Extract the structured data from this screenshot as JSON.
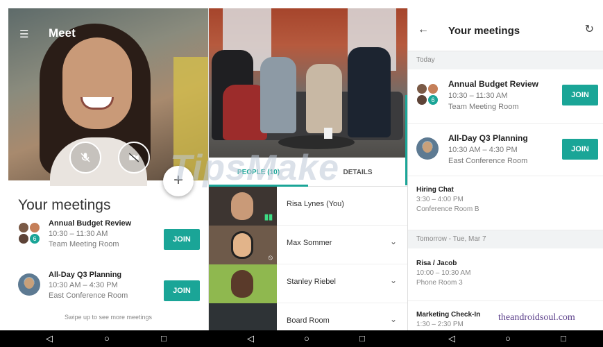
{
  "panel1": {
    "app_title": "Meet",
    "heading": "Your meetings",
    "fab_label": "+",
    "meetings": [
      {
        "title": "Annual Budget Review",
        "time": "10:30 – 11:30 AM",
        "room": "Team Meeting Room",
        "join": "JOIN"
      },
      {
        "title": "All-Day Q3 Planning",
        "time": "10:30 AM – 4:30 PM",
        "room": "East Conference Room",
        "join": "JOIN"
      }
    ],
    "swipe_hint": "Swipe up to see more meetings"
  },
  "panel2": {
    "tabs": [
      "PEOPLE (10)",
      "DETAILS"
    ],
    "people": [
      {
        "name": "Risa Lynes (You)"
      },
      {
        "name": "Max Sommer"
      },
      {
        "name": "Stanley Riebel"
      },
      {
        "name": "Board Room"
      }
    ]
  },
  "panel3": {
    "title": "Your meetings",
    "today_header": "Today",
    "today": [
      {
        "title": "Annual Budget Review",
        "time": "10:30 – 11:30 AM",
        "room": "Team Meeting Room",
        "join": "JOIN"
      },
      {
        "title": "All-Day Q3 Planning",
        "time": "10:30 AM – 4:30 PM",
        "room": "East Conference Room",
        "join": "JOIN"
      },
      {
        "title": "Hiring Chat",
        "time": "3:30 – 4:00 PM",
        "room": "Conference Room B"
      }
    ],
    "tomorrow_header": "Tomorrow - Tue, Mar 7",
    "tomorrow": [
      {
        "title": "Risa / Jacob",
        "time": "10:00 – 10:30 AM",
        "room": "Phone Room 3"
      },
      {
        "title": "Marketing Check-In",
        "time": "1:30 – 2:30 PM"
      }
    ]
  },
  "watermarks": {
    "site": "theandroidsoul.com",
    "overlay": "TipsMake"
  },
  "colors": {
    "accent": "#1aa597",
    "navbar": "#000000"
  },
  "icons": {
    "menu": "menu-icon",
    "mic_off": "mic-off-icon",
    "camera_off": "camera-off-icon",
    "back": "arrow-back-icon",
    "refresh": "refresh-icon"
  }
}
